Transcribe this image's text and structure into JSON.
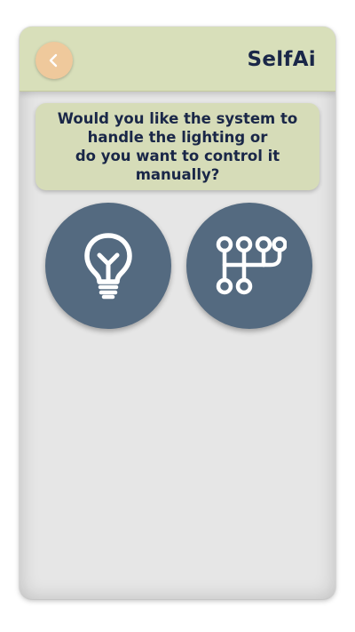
{
  "header": {
    "title": "SelfAi",
    "back_icon": "chevron-left-icon"
  },
  "question": {
    "lines": [
      "Would you like the system to",
      "handle the lighting or",
      "do you want to control it",
      "manually?"
    ]
  },
  "options": [
    {
      "id": "automatic",
      "icon": "lightbulb-icon"
    },
    {
      "id": "manual",
      "icon": "manual-control-icon"
    }
  ],
  "colors": {
    "header_bg": "#d8dfba",
    "back_button": "#efc99c",
    "text_dark": "#1a2748",
    "option_circle": "#546a80",
    "background": "#e6e6e6"
  }
}
